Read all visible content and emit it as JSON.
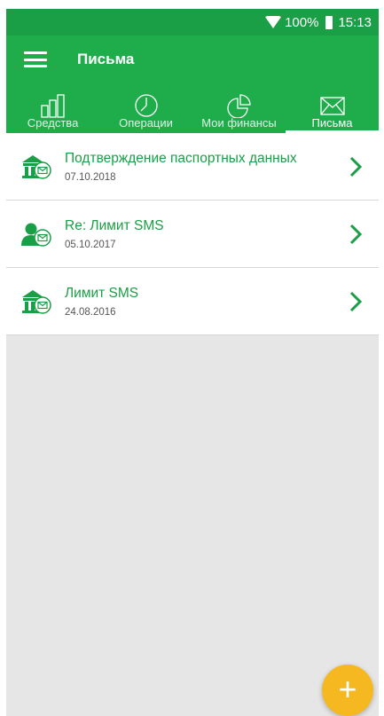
{
  "status": {
    "battery_percent": "100%",
    "time": "15:13"
  },
  "header": {
    "title": "Письма"
  },
  "tabs": [
    {
      "label": "Средства",
      "icon": "bars-chart-icon"
    },
    {
      "label": "Операции",
      "icon": "clock-icon"
    },
    {
      "label": "Мои финансы",
      "icon": "pie-chart-icon"
    },
    {
      "label": "Письма",
      "icon": "envelope-icon",
      "active": true
    }
  ],
  "letters": [
    {
      "title": "Подтверждение паспортных данных",
      "date": "07.10.2018",
      "icon": "bank-envelope-icon"
    },
    {
      "title": "Re: Лимит SMS",
      "date": "05.10.2017",
      "icon": "person-envelope-icon"
    },
    {
      "title": "Лимит SMS",
      "date": "24.08.2016",
      "icon": "bank-envelope-icon"
    }
  ],
  "fab": {
    "label": "+"
  },
  "colors": {
    "primary": "#1fad4c",
    "status_bar": "#1a9e46",
    "fab": "#f5b820",
    "background": "#e6e6e6"
  }
}
